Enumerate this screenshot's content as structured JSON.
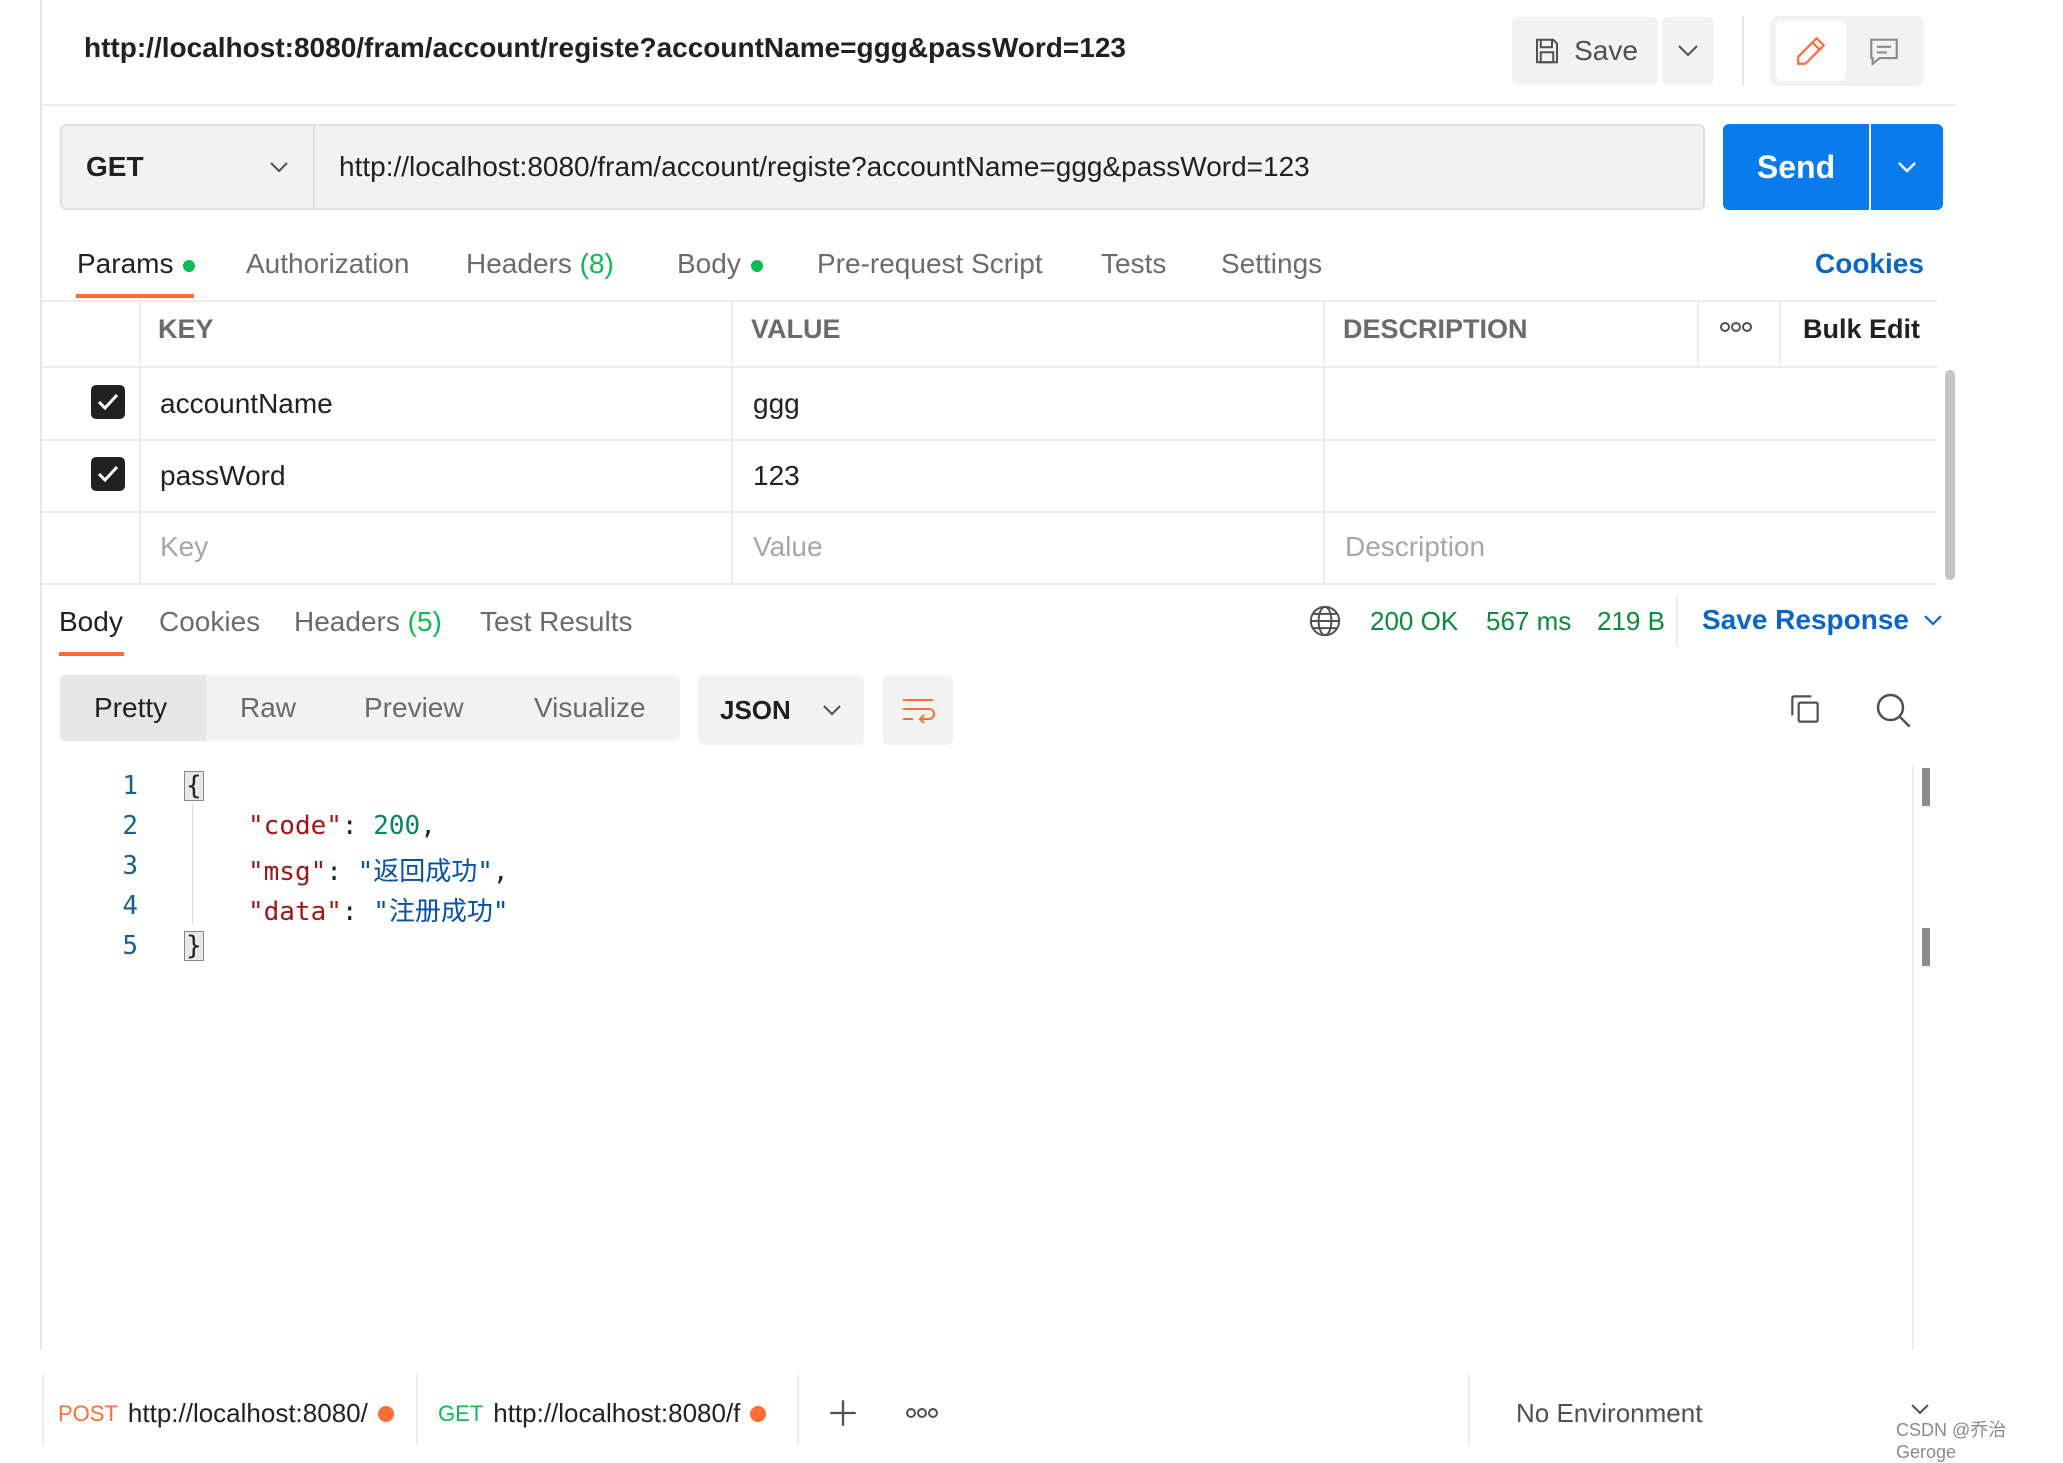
{
  "header": {
    "title": "http://localhost:8080/fram/account/registe?accountName=ggg&passWord=123",
    "save_label": "Save"
  },
  "request": {
    "method": "GET",
    "url": "http://localhost:8080/fram/account/registe?accountName=ggg&passWord=123",
    "send_label": "Send"
  },
  "request_tabs": {
    "params": "Params",
    "authorization": "Authorization",
    "headers": "Headers",
    "headers_count": "(8)",
    "body": "Body",
    "pre_request": "Pre-request Script",
    "tests": "Tests",
    "settings": "Settings",
    "cookies": "Cookies"
  },
  "params_table": {
    "columns": {
      "key": "KEY",
      "value": "VALUE",
      "description": "DESCRIPTION"
    },
    "bulk_edit": "Bulk Edit",
    "rows": [
      {
        "key": "accountName",
        "value": "ggg",
        "checked": true
      },
      {
        "key": "passWord",
        "value": "123",
        "checked": true
      }
    ],
    "placeholders": {
      "key": "Key",
      "value": "Value",
      "description": "Description"
    }
  },
  "response_tabs": {
    "body": "Body",
    "cookies": "Cookies",
    "headers": "Headers",
    "headers_count": "(5)",
    "test_results": "Test Results"
  },
  "response_status": {
    "status": "200 OK",
    "time": "567 ms",
    "size": "219 B",
    "save_response": "Save Response"
  },
  "response_view": {
    "pretty": "Pretty",
    "raw": "Raw",
    "preview": "Preview",
    "visualize": "Visualize",
    "format": "JSON"
  },
  "code": {
    "line_numbers": [
      "1",
      "2",
      "3",
      "4",
      "5"
    ],
    "open_brace": "{",
    "close_brace": "}",
    "fields": [
      {
        "key": "\"code\"",
        "value": "200",
        "type": "number",
        "comma": ","
      },
      {
        "key": "\"msg\"",
        "value": "\"返回成功\"",
        "type": "string",
        "comma": ","
      },
      {
        "key": "\"data\"",
        "value": "\"注册成功\"",
        "type": "string",
        "comma": ""
      }
    ]
  },
  "bottom_tabs": [
    {
      "method": "POST",
      "url": "http://localhost:8080/"
    },
    {
      "method": "GET",
      "url": "http://localhost:8080/f"
    }
  ],
  "environment": "No Environment",
  "watermark": "CSDN @乔治Geroge",
  "colors": {
    "accent_orange": "#ff6c37",
    "send_blue": "#097bed",
    "link_blue": "#0b65c2",
    "success_green": "#0a8a3a"
  }
}
